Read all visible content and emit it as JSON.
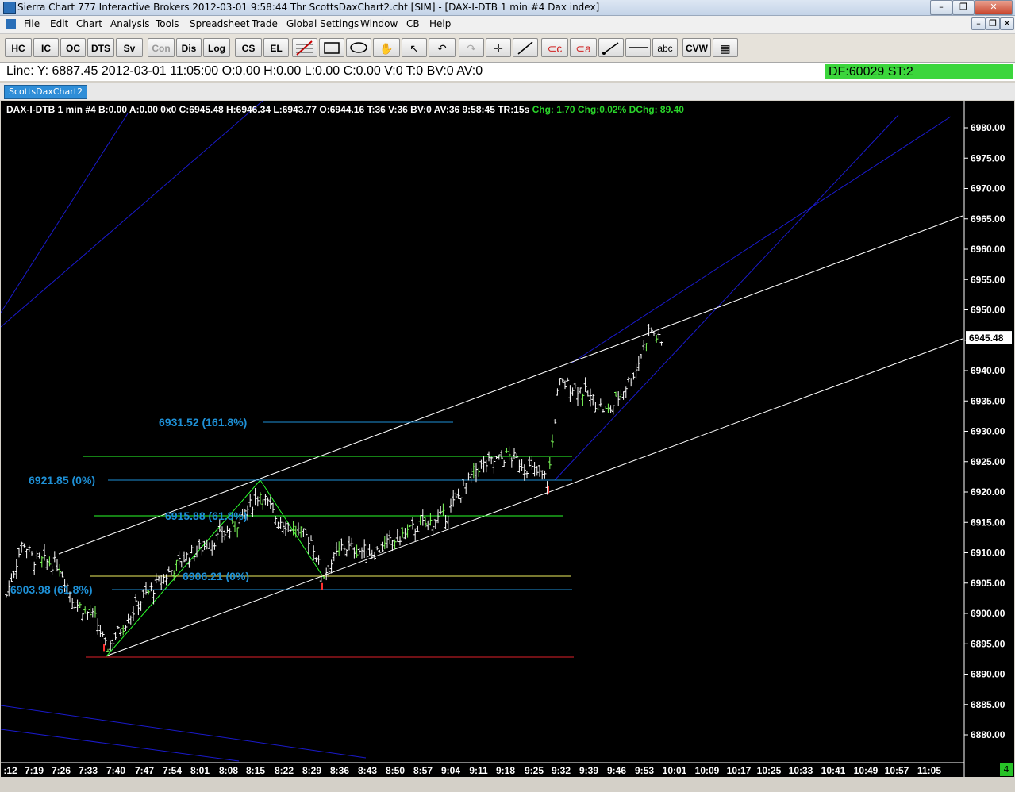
{
  "window": {
    "title": "Sierra Chart 777 Interactive Brokers 2012-03-01  9:58:44 Thr  ScottsDaxChart2.cht [SIM] - [DAX-I-DTB  1 min  #4  Dax index]",
    "min": "–",
    "restore": "❐",
    "close": "✕"
  },
  "menu": [
    "File",
    "Edit",
    "Chart",
    "Analysis",
    "Tools",
    "Spreadsheet",
    "Trade",
    "Global Settings",
    "Window",
    "CB",
    "Help"
  ],
  "toolbar": [
    "HC",
    "IC",
    "OC",
    "DTS",
    "Sv",
    "Con",
    "Dis",
    "Log",
    "CS",
    "EL",
    "abc",
    "CVW"
  ],
  "info": {
    "line": "Line: Y: 6887.45  2012-03-01  11:05:00  O:0.00  H:0.00  L:0.00  C:0.00  V:0  T:0  BV:0  AV:0",
    "df": "DF:60029  ST:2"
  },
  "tab": "ScottsDaxChart2",
  "header": {
    "main": "DAX-I-DTB  1 min   #4 B:0.00 A:0.00 0x0 C:6945.48 H:6946.34 L:6943.77 O:6944.16 T:36 V:36 BV:0 AV:36 9:58:45 TR:15s",
    "chg": "Chg: 1.70 Chg:0.02% DChg: 89.40"
  },
  "colors": {
    "background": "#000000",
    "bars": "#ffffff",
    "bar_accent": "#7dff5a",
    "fib_text": "#1e90d6",
    "trend_white": "#ffffff",
    "trend_blue": "#1a1acc",
    "trend_green": "#2aff2a",
    "level_red": "#e0202a",
    "level_yellow": "#f0f060"
  },
  "chart_data": {
    "type": "ohlc",
    "symbol": "DAX-I-DTB",
    "interval": "1 min",
    "y_ticks": [
      "6980.00",
      "6975.00",
      "6970.00",
      "6965.00",
      "6960.00",
      "6955.00",
      "6950.00",
      "6945.00",
      "6940.00",
      "6935.00",
      "6930.00",
      "6925.00",
      "6920.00",
      "6915.00",
      "6910.00",
      "6905.00",
      "6900.00",
      "6895.00",
      "6890.00",
      "6885.00",
      "6880.00"
    ],
    "x_ticks": [
      ":12",
      "7:19",
      "7:26",
      "7:33",
      "7:40",
      "7:47",
      "7:54",
      "8:01",
      "8:08",
      "8:15",
      "8:22",
      "8:29",
      "8:36",
      "8:43",
      "8:50",
      "8:57",
      "9:04",
      "9:11",
      "9:18",
      "9:25",
      "9:32",
      "9:39",
      "9:46",
      "9:53",
      "10:01",
      "10:09",
      "10:17",
      "10:25",
      "10:33",
      "10:41",
      "10:49",
      "10:57",
      "11:05"
    ],
    "last_price": "6945.48",
    "annotations": [
      "6931.52 (161.8%)",
      "6921.85 (0%)",
      "6915.88 (61.8%)",
      "6906.21 (0%)",
      "6903.98 (61.8%)"
    ],
    "ylim": [
      6877,
      6983
    ]
  }
}
